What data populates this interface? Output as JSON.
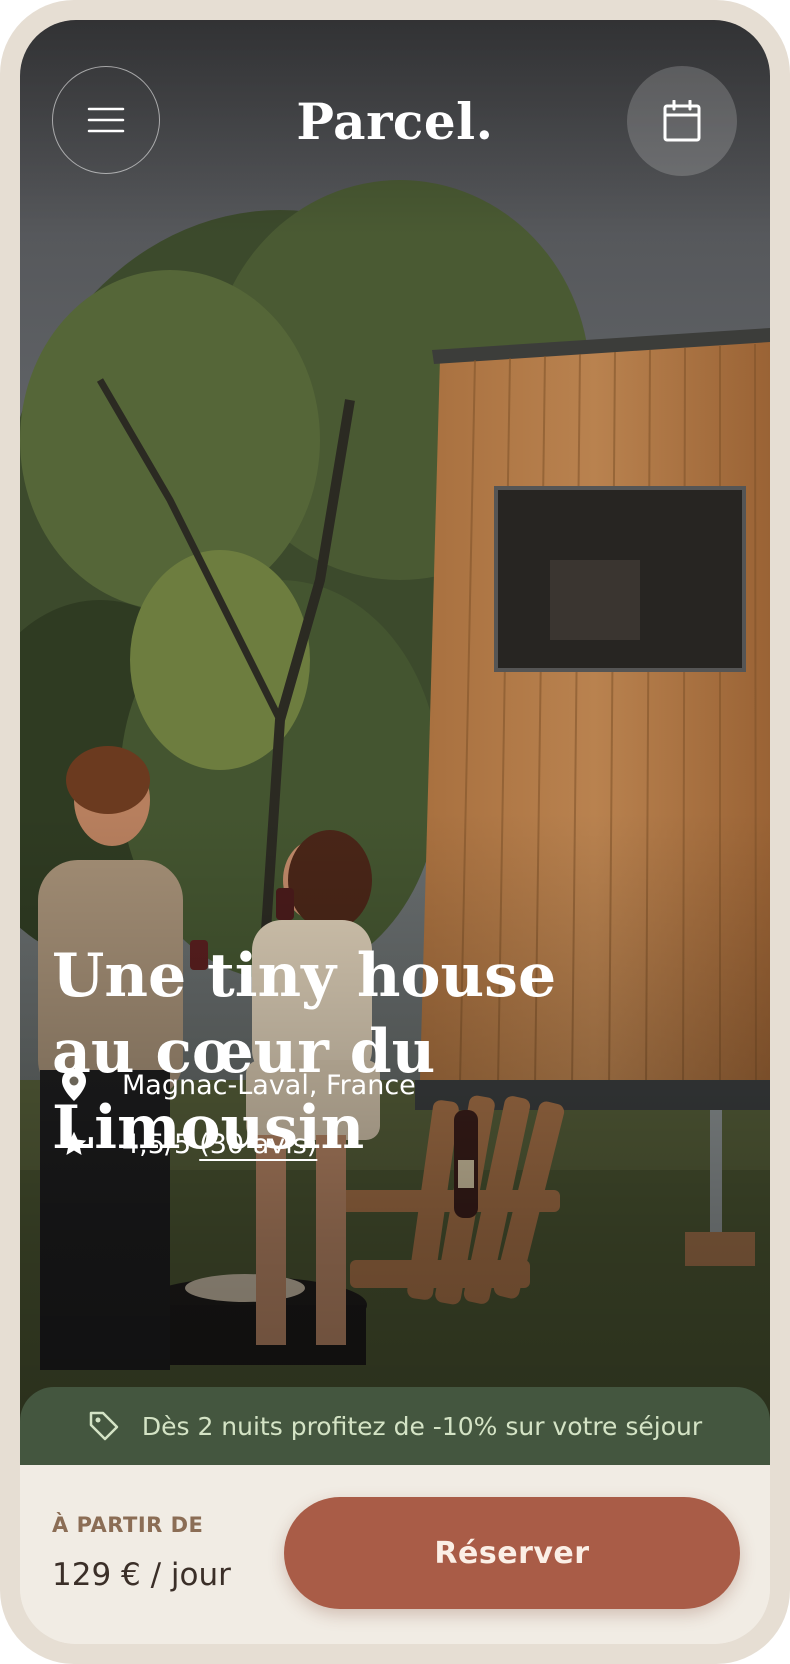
{
  "header": {
    "logo": "Parcel.",
    "menu_icon": "hamburger-menu-icon",
    "calendar_icon": "calendar-icon"
  },
  "hero": {
    "title_line1": "Une tiny house",
    "title_line2": "au cœur du Limousin",
    "location": "Magnac-Laval, France",
    "rating": "4,5/5",
    "reviews": "(30 avis)"
  },
  "promo": {
    "text": "Dès 2 nuits profitez de -10% sur votre séjour",
    "icon": "tag-icon"
  },
  "booking": {
    "price_label": "À PARTIR DE",
    "price": "129 € / jour",
    "reserve_label": "Réserver"
  },
  "colors": {
    "promo_bg": "#44563f",
    "reserve_bg": "#a95c47",
    "frame": "#e6ded3",
    "panel_bg": "#f1ece4"
  }
}
